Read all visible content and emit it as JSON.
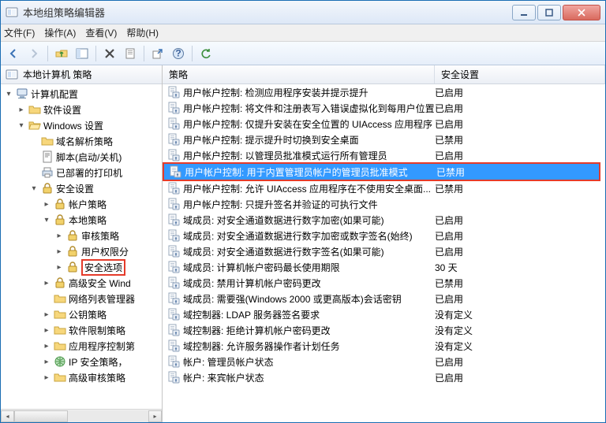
{
  "window": {
    "title": "本地组策略编辑器"
  },
  "menubar": {
    "file": "文件(F)",
    "action": "操作(A)",
    "view": "查看(V)",
    "help": "帮助(H)"
  },
  "tree": {
    "header": "本地计算机 策略",
    "items": [
      {
        "indent": 0,
        "exp": "▾",
        "icon": "computer",
        "label": "计算机配置"
      },
      {
        "indent": 1,
        "exp": "▸",
        "icon": "folder",
        "label": "软件设置"
      },
      {
        "indent": 1,
        "exp": "▾",
        "icon": "folder-open",
        "label": "Windows 设置"
      },
      {
        "indent": 2,
        "exp": "",
        "icon": "folder",
        "label": "域名解析策略"
      },
      {
        "indent": 2,
        "exp": "",
        "icon": "script",
        "label": "脚本(启动/关机)"
      },
      {
        "indent": 2,
        "exp": "",
        "icon": "printer",
        "label": "已部署的打印机"
      },
      {
        "indent": 2,
        "exp": "▾",
        "icon": "lock",
        "label": "安全设置"
      },
      {
        "indent": 3,
        "exp": "▸",
        "icon": "lock-sub",
        "label": "帐户策略"
      },
      {
        "indent": 3,
        "exp": "▾",
        "icon": "lock-sub",
        "label": "本地策略"
      },
      {
        "indent": 4,
        "exp": "▸",
        "icon": "lock-sub",
        "label": "审核策略"
      },
      {
        "indent": 4,
        "exp": "▸",
        "icon": "lock-sub",
        "label": "用户权限分"
      },
      {
        "indent": 4,
        "exp": "▸",
        "icon": "lock-sub",
        "label": "安全选项",
        "highlighted": true
      },
      {
        "indent": 3,
        "exp": "▸",
        "icon": "lock-sub",
        "label": "高级安全 Wind"
      },
      {
        "indent": 3,
        "exp": "",
        "icon": "folder",
        "label": "网络列表管理器"
      },
      {
        "indent": 3,
        "exp": "▸",
        "icon": "folder",
        "label": "公钥策略"
      },
      {
        "indent": 3,
        "exp": "▸",
        "icon": "folder",
        "label": "软件限制策略"
      },
      {
        "indent": 3,
        "exp": "▸",
        "icon": "folder",
        "label": "应用程序控制第"
      },
      {
        "indent": 3,
        "exp": "▸",
        "icon": "ip",
        "label": "IP 安全策略，"
      },
      {
        "indent": 3,
        "exp": "▸",
        "icon": "folder",
        "label": "高级审核策略"
      }
    ]
  },
  "list": {
    "col_policy": "策略",
    "col_setting": "安全设置",
    "rows": [
      {
        "policy": "用户帐户控制: 检测应用程序安装并提示提升",
        "setting": "已启用"
      },
      {
        "policy": "用户帐户控制: 将文件和注册表写入错误虚拟化到每用户位置",
        "setting": "已启用"
      },
      {
        "policy": "用户帐户控制: 仅提升安装在安全位置的 UIAccess 应用程序",
        "setting": "已启用"
      },
      {
        "policy": "用户帐户控制: 提示提升时切换到安全桌面",
        "setting": "已禁用"
      },
      {
        "policy": "用户帐户控制: 以管理员批准模式运行所有管理员",
        "setting": "已启用"
      },
      {
        "policy": "用户帐户控制: 用于内置管理员帐户的管理员批准模式",
        "setting": "已禁用",
        "selected": true,
        "highlighted": true
      },
      {
        "policy": "用户帐户控制: 允许 UIAccess 应用程序在不使用安全桌面...",
        "setting": "已禁用"
      },
      {
        "policy": "用户帐户控制: 只提升签名并验证的可执行文件",
        "setting": ""
      },
      {
        "policy": "域成员: 对安全通道数据进行数字加密(如果可能)",
        "setting": "已启用"
      },
      {
        "policy": "域成员: 对安全通道数据进行数字加密或数字签名(始终)",
        "setting": "已启用"
      },
      {
        "policy": "域成员: 对安全通道数据进行数字签名(如果可能)",
        "setting": "已启用"
      },
      {
        "policy": "域成员: 计算机帐户密码最长使用期限",
        "setting": "30 天"
      },
      {
        "policy": "域成员: 禁用计算机帐户密码更改",
        "setting": "已禁用"
      },
      {
        "policy": "域成员: 需要强(Windows 2000 或更高版本)会话密钥",
        "setting": "已启用"
      },
      {
        "policy": "域控制器: LDAP 服务器签名要求",
        "setting": "没有定义"
      },
      {
        "policy": "域控制器: 拒绝计算机帐户密码更改",
        "setting": "没有定义"
      },
      {
        "policy": "域控制器: 允许服务器操作者计划任务",
        "setting": "没有定义"
      },
      {
        "policy": "帐户: 管理员帐户状态",
        "setting": "已启用"
      },
      {
        "policy": "帐户: 来宾帐户状态",
        "setting": "已启用"
      }
    ]
  }
}
